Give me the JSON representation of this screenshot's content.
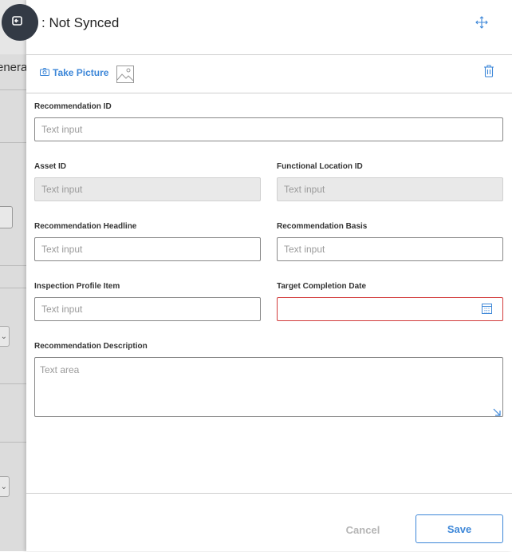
{
  "background": {
    "tab_fragment": "enera"
  },
  "panel": {
    "title": ": Not Synced"
  },
  "toolbar": {
    "take_picture_label": "Take Picture"
  },
  "form": {
    "recommendation_id": {
      "label": "Recommendation ID",
      "placeholder": "Text input",
      "value": ""
    },
    "asset_id": {
      "label": "Asset ID",
      "placeholder": "Text input",
      "value": ""
    },
    "functional_location_id": {
      "label": "Functional Location ID",
      "placeholder": "Text input",
      "value": ""
    },
    "recommendation_headline": {
      "label": "Recommendation Headline",
      "placeholder": "Text input",
      "value": ""
    },
    "recommendation_basis": {
      "label": "Recommendation Basis",
      "placeholder": "Text input",
      "value": ""
    },
    "inspection_profile_item": {
      "label": "Inspection Profile Item",
      "placeholder": "Text input",
      "value": ""
    },
    "target_completion_date": {
      "label": "Target Completion Date",
      "placeholder": "",
      "value": ""
    },
    "recommendation_description": {
      "label": "Recommendation Description",
      "placeholder": "Text area",
      "value": ""
    }
  },
  "footer": {
    "cancel_label": "Cancel",
    "save_label": "Save"
  },
  "colors": {
    "accent": "#3d87d8",
    "error": "#d23b3b",
    "disabled_bg": "#e9e9e9"
  },
  "icons": [
    "nav-back-icon",
    "expand-icon",
    "camera-icon",
    "image-icon",
    "trash-icon",
    "calendar-icon",
    "resize-handle-icon"
  ]
}
